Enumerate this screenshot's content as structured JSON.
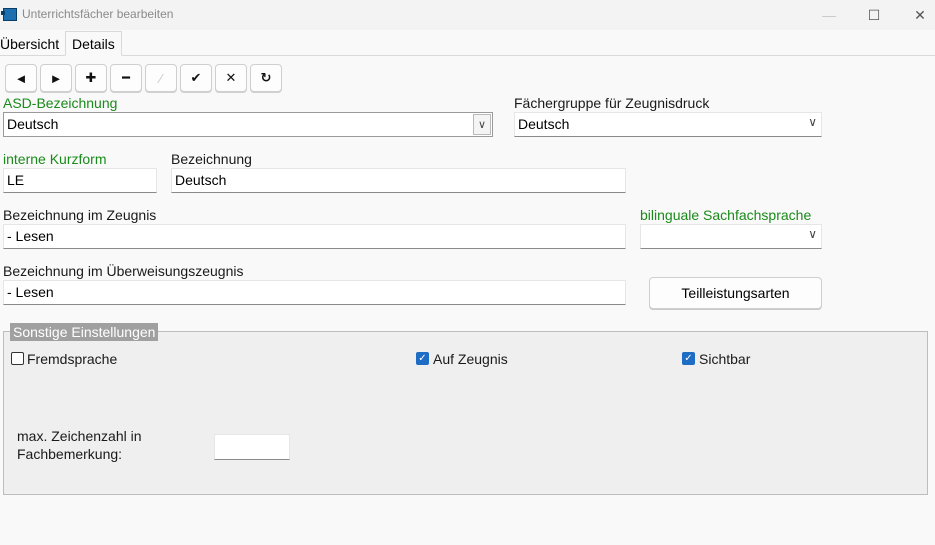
{
  "window": {
    "title": "Unterrichtsfächer bearbeiten",
    "controls": {
      "minimize": "—",
      "maximize": "☐",
      "close": "✕"
    }
  },
  "tabs": [
    {
      "label": "Übersicht",
      "active": false
    },
    {
      "label": "Details",
      "active": true
    }
  ],
  "toolbar": {
    "prev": "◄",
    "next": "►",
    "add": "✚",
    "remove": "━",
    "edit": "⁄",
    "confirm": "✔",
    "cancel": "✕",
    "refresh": "↻"
  },
  "form": {
    "asd_label": "ASD-Bezeichnung",
    "asd_value": "Deutsch",
    "faechergruppe_label": "Fächergruppe für Zeugnisdruck",
    "faechergruppe_value": "Deutsch",
    "kurzform_label": "interne Kurzform",
    "kurzform_value": "LE",
    "bezeichnung_label": "Bezeichnung",
    "bezeichnung_value": "Deutsch",
    "zeugnis_label": "Bezeichnung im Zeugnis",
    "zeugnis_value": "- Lesen",
    "bilingual_label": "bilinguale Sachfachsprache",
    "bilingual_value": "",
    "ueberweisung_label": "Bezeichnung im Überweisungszeugnis",
    "ueberweisung_value": "- Lesen",
    "teilleistung_button": "Teilleistungsarten"
  },
  "settings": {
    "group_title": "Sonstige Einstellungen",
    "fremdsprache_label": "Fremdsprache",
    "fremdsprache_checked": false,
    "auf_zeugnis_label": "Auf Zeugnis",
    "auf_zeugnis_checked": true,
    "sichtbar_label": "Sichtbar",
    "sichtbar_checked": true,
    "max_zeichen_label_line1": "max. Zeichenzahl in",
    "max_zeichen_label_line2": "Fachbemerkung:",
    "max_zeichen_value": ""
  },
  "colors": {
    "required_label": "#1a8a1a",
    "checkbox_checked": "#1f6cc4"
  }
}
